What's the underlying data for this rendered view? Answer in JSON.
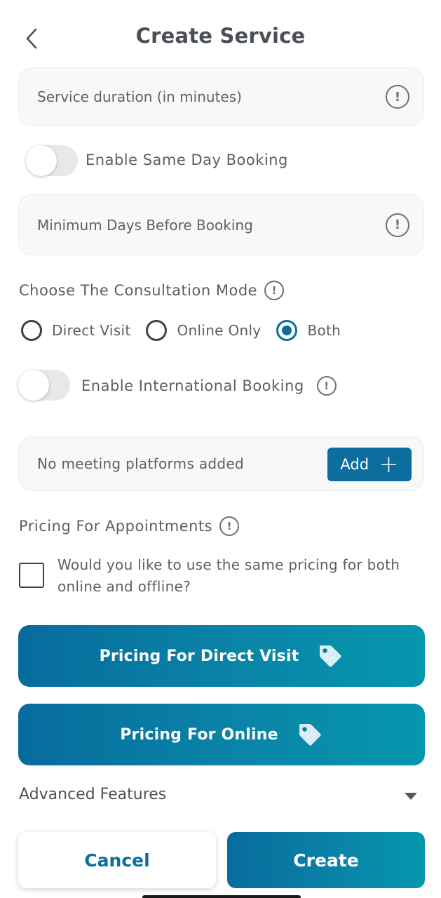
{
  "header": {
    "title": "Create Service"
  },
  "fields": {
    "duration_placeholder": "Service duration (in minutes)",
    "min_days_placeholder": "Minimum Days Before Booking"
  },
  "toggles": {
    "same_day_label": "Enable Same Day Booking",
    "same_day_on": false,
    "international_label": "Enable International Booking",
    "international_on": false
  },
  "consultation": {
    "label": "Choose The Consultation Mode",
    "options": [
      "Direct Visit",
      "Online Only",
      "Both"
    ],
    "selected": "Both"
  },
  "meeting": {
    "empty_text": "No meeting platforms added",
    "add_label": "Add"
  },
  "pricing": {
    "label": "Pricing For Appointments",
    "same_pricing_question": "Would you like to use the same pricing for both online and offline?",
    "same_pricing_checked": false,
    "direct_visit_button": "Pricing For Direct Visit",
    "online_button": "Pricing For Online"
  },
  "advanced": {
    "label": "Advanced Features"
  },
  "actions": {
    "cancel": "Cancel",
    "create": "Create"
  },
  "colors": {
    "primary": "#0b6e9e",
    "gradient_end": "#0497ad"
  },
  "icons": {
    "back": "chevron-left-icon",
    "info": "info-icon",
    "tag": "price-tag-icon",
    "plus": "plus-icon",
    "caret": "caret-down-icon"
  }
}
